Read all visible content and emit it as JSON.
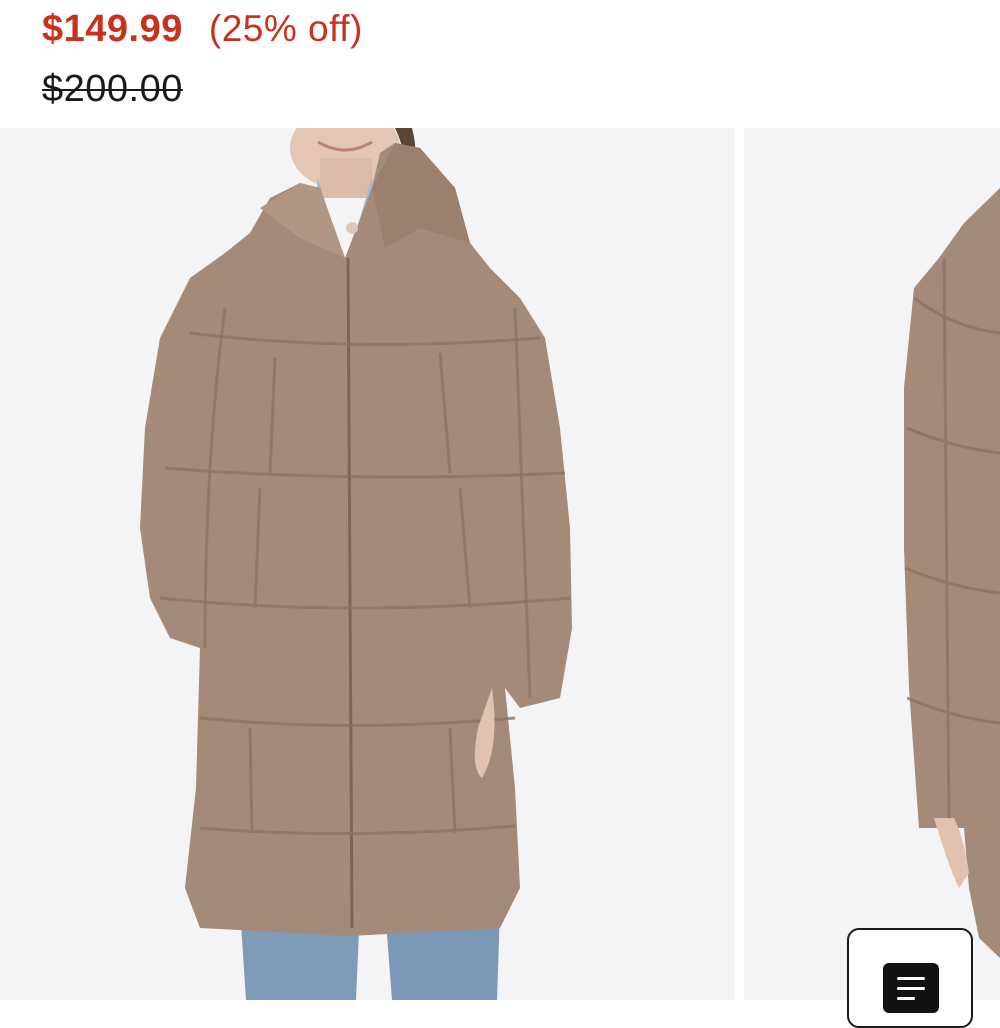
{
  "product": {
    "sale_price": "$149.99",
    "discount_label": "(25% off)",
    "original_price": "$200.00"
  },
  "gallery": {
    "images": [
      {
        "name": "product-image-front",
        "subject": "Woman wearing a taupe sherpa quilted long puffer coat with stand collar over a denim shirt and jeans"
      },
      {
        "name": "product-image-side",
        "subject": "Side view of the taupe sherpa quilted long puffer coat"
      }
    ]
  },
  "colors": {
    "sale_price": "#c8311c",
    "discount": "#c8311c",
    "original_price": "#1a1a1a",
    "photo_background": "#f4f3f5",
    "coat": "#a48a78"
  },
  "menu_button": {
    "icon": "menu-lines-icon"
  }
}
